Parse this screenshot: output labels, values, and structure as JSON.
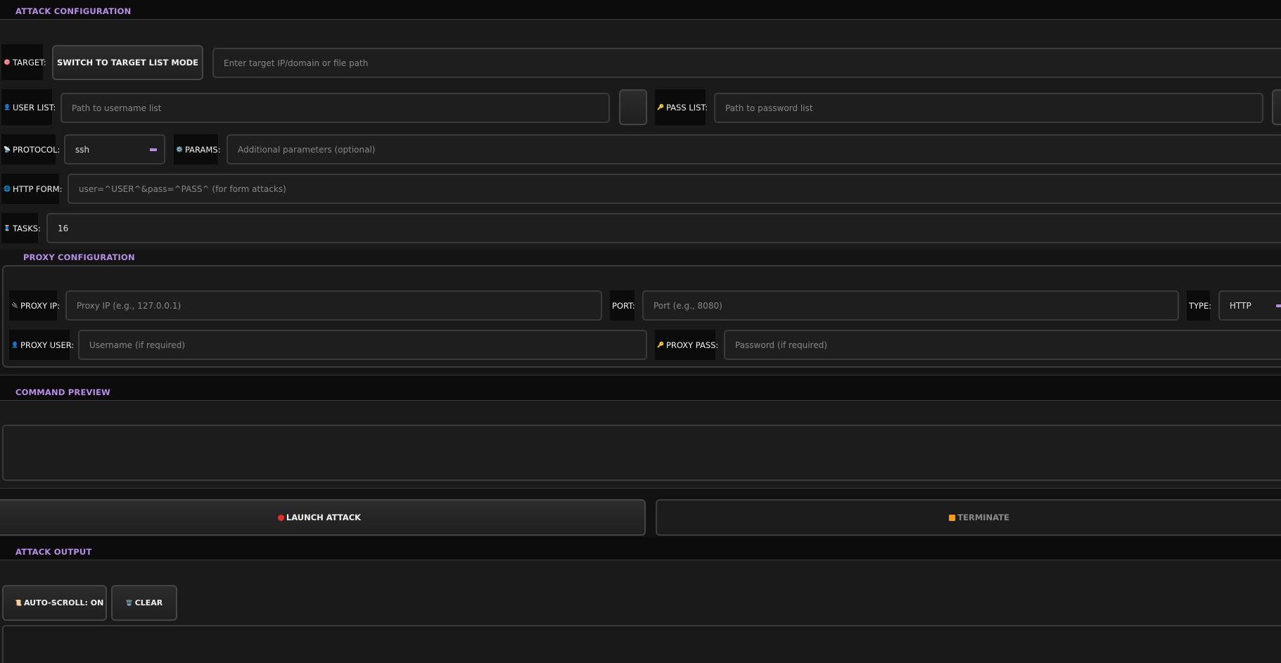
{
  "attack_config": {
    "title": "ATTACK CONFIGURATION",
    "target": {
      "label": "TARGET:",
      "icon": "target-icon",
      "mode_button": "SWITCH TO TARGET LIST MODE",
      "placeholder": "Enter target IP/domain or file path"
    },
    "user_list": {
      "label": "USER LIST:",
      "icon": "user-icon",
      "placeholder": "Path to username list"
    },
    "pass_list": {
      "label": "PASS LIST:",
      "icon": "key-icon",
      "placeholder": "Path to password list"
    },
    "protocol": {
      "label": "PROTOCOL:",
      "icon": "satellite-icon",
      "value": "ssh"
    },
    "params": {
      "label": "PARAMS:",
      "icon": "gear-icon",
      "placeholder": "Additional parameters (optional)"
    },
    "http_form": {
      "label": "HTTP FORM:",
      "icon": "globe-icon",
      "placeholder": "user=^USER^&pass=^PASS^ (for form attacks)"
    },
    "tasks": {
      "label": "TASKS:",
      "icon": "thread-icon",
      "value": "16"
    }
  },
  "proxy_config": {
    "title": "PROXY CONFIGURATION",
    "ip": {
      "label": "PROXY IP:",
      "icon": "plug-icon",
      "placeholder": "Proxy IP (e.g., 127.0.0.1)"
    },
    "port": {
      "label": "PORT:",
      "placeholder": "Port (e.g., 8080)"
    },
    "type": {
      "label": "TYPE:",
      "value": "HTTP"
    },
    "user": {
      "label": "PROXY USER:",
      "icon": "user-icon",
      "placeholder": "Username (if required)"
    },
    "pass": {
      "label": "PROXY PASS:",
      "icon": "key-icon",
      "placeholder": "Password (if required)"
    }
  },
  "command_preview": {
    "title": "COMMAND PREVIEW",
    "text": ""
  },
  "actions": {
    "launch": "LAUNCH ATTACK",
    "terminate": "TERMINATE"
  },
  "output": {
    "title": "ATTACK OUTPUT",
    "autoscroll": "AUTO-SCROLL: ON",
    "clear": "CLEAR",
    "text": ""
  },
  "colors": {
    "accent": "#b98ee6",
    "background": "#141414",
    "field": "#1e1e1e",
    "label_bg": "#0b0b0b",
    "danger": "#e0302a",
    "warning": "#f29a1a"
  }
}
